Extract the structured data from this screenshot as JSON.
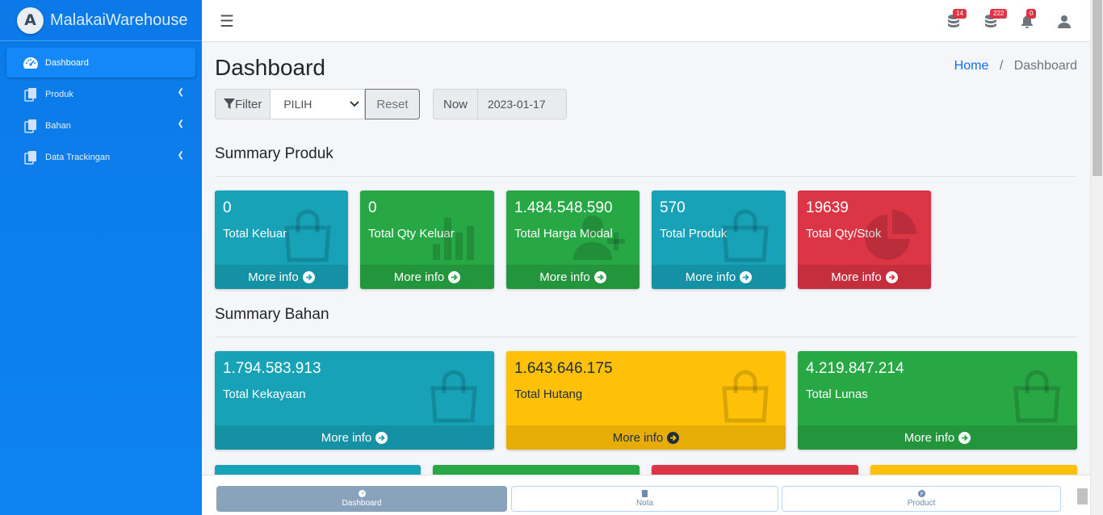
{
  "brand": {
    "logo_letter": "A",
    "name": "MalakaiWarehouse"
  },
  "sidebar": {
    "items": [
      {
        "label": "Dashboard",
        "icon": "tachometer-icon",
        "active": true
      },
      {
        "label": "Produk",
        "icon": "copy-icon"
      },
      {
        "label": "Bahan",
        "icon": "copy-icon"
      },
      {
        "label": "Data Trackingan",
        "icon": "copy-icon"
      }
    ]
  },
  "topbar": {
    "icons": [
      {
        "name": "database-icon",
        "badge": "14"
      },
      {
        "name": "database-icon",
        "badge": "222"
      },
      {
        "name": "bell-icon",
        "badge": "0"
      },
      {
        "name": "user-icon"
      }
    ]
  },
  "page": {
    "title": "Dashboard",
    "breadcrumb": {
      "home": "Home",
      "sep": "/",
      "current": "Dashboard"
    }
  },
  "filter": {
    "label": "Filter",
    "select_value": "PILIH",
    "reset_label": "Reset",
    "now_label": "Now",
    "now_value": "2023-01-17"
  },
  "summary_produk": {
    "title": "Summary Produk",
    "cards": [
      {
        "value": "0",
        "label": "Total Keluar",
        "footer": "More info",
        "color": "#17a2b8",
        "icon": "shopping-bag-icon"
      },
      {
        "value": "0",
        "label": "Total Qty Keluar",
        "footer": "More info",
        "color": "#28a745",
        "icon": "bar-chart-icon"
      },
      {
        "value": "1.484.548.590",
        "label": "Total Harga Modal",
        "footer": "More info",
        "color": "#28a745",
        "icon": "user-plus-icon"
      },
      {
        "value": "570",
        "label": "Total Produk",
        "footer": "More info",
        "color": "#17a2b8",
        "icon": "shopping-bag-icon"
      },
      {
        "value": "19639",
        "label": "Total Qty/Stok",
        "footer": "More info",
        "color": "#dc3545",
        "icon": "pie-chart-icon"
      }
    ]
  },
  "summary_bahan": {
    "title": "Summary Bahan",
    "cards": [
      {
        "value": "1.794.583.913",
        "label": "Total Kekayaan",
        "footer": "More info",
        "color": "#17a2b8",
        "icon": "shopping-bag-icon"
      },
      {
        "value": "1.643.646.175",
        "label": "Total Hutang",
        "footer": "More info",
        "color": "#ffc107",
        "icon": "shopping-bag-icon"
      },
      {
        "value": "4.219.847.214",
        "label": "Total Lunas",
        "footer": "More info",
        "color": "#28a745",
        "icon": "shopping-bag-icon"
      }
    ]
  },
  "bottom_nav": {
    "items": [
      {
        "label": "Dashboard",
        "icon": "tachometer-icon",
        "active": true
      },
      {
        "label": "Nota",
        "icon": "note-icon"
      },
      {
        "label": "Product",
        "icon": "product-icon"
      }
    ]
  }
}
